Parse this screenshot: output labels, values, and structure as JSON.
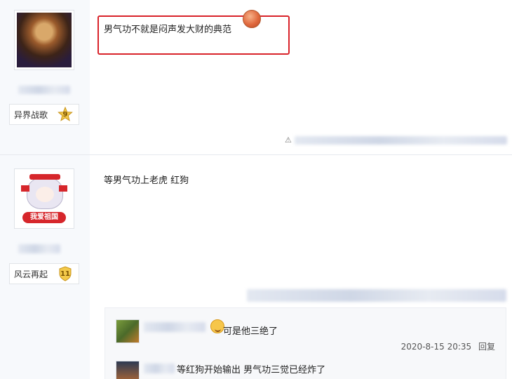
{
  "posts": [
    {
      "badge_name": "异界战歌",
      "level": "9",
      "content": "男气功不就是闷声发大财的典范"
    },
    {
      "badge_name": "风云再起",
      "level": "11",
      "content": "等男气功上老虎 红狗"
    }
  ],
  "replies": [
    {
      "content": "可是他三绝了",
      "time": "2020-8-15 20:35",
      "reply_label": "回复"
    },
    {
      "content": "等红狗开始输出 男气功三觉已经炸了"
    }
  ],
  "post2_avatar_banner": "我爱祖国",
  "colors": {
    "highlight": "#d9232a",
    "sidebar_bg": "#f7f9fc"
  }
}
